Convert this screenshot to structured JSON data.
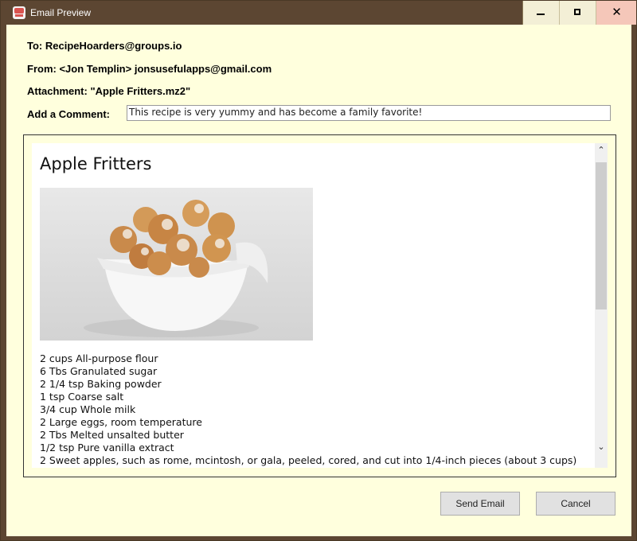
{
  "window": {
    "title": "Email Preview",
    "close_glyph": "✕"
  },
  "email": {
    "to_line": "To: RecipeHoarders@groups.io",
    "from_line": "From: <Jon Templin> jonsusefulapps@gmail.com",
    "attachment_line": "Attachment: \"Apple Fritters.mz2\"",
    "comment_label": "Add a Comment:",
    "comment_value": "This recipe is very yummy and has become a family favorite!"
  },
  "preview": {
    "recipe_title": "Apple Fritters",
    "ingredients": [
      "2 cups All-purpose flour",
      "6 Tbs Granulated sugar",
      "2 1/4 tsp Baking powder",
      "1 tsp Coarse salt",
      "3/4 cup Whole milk",
      "2 Large eggs, room temperature",
      "2 Tbs Melted unsalted butter",
      "1/2 tsp Pure vanilla extract",
      "2 Sweet apples, such as rome, mcintosh, or gala, peeled, cored, and cut into 1/4-inch pieces (about 3 cups)"
    ],
    "scroll_up": "⌃",
    "scroll_down": "⌄"
  },
  "buttons": {
    "send": "Send Email",
    "cancel": "Cancel"
  }
}
